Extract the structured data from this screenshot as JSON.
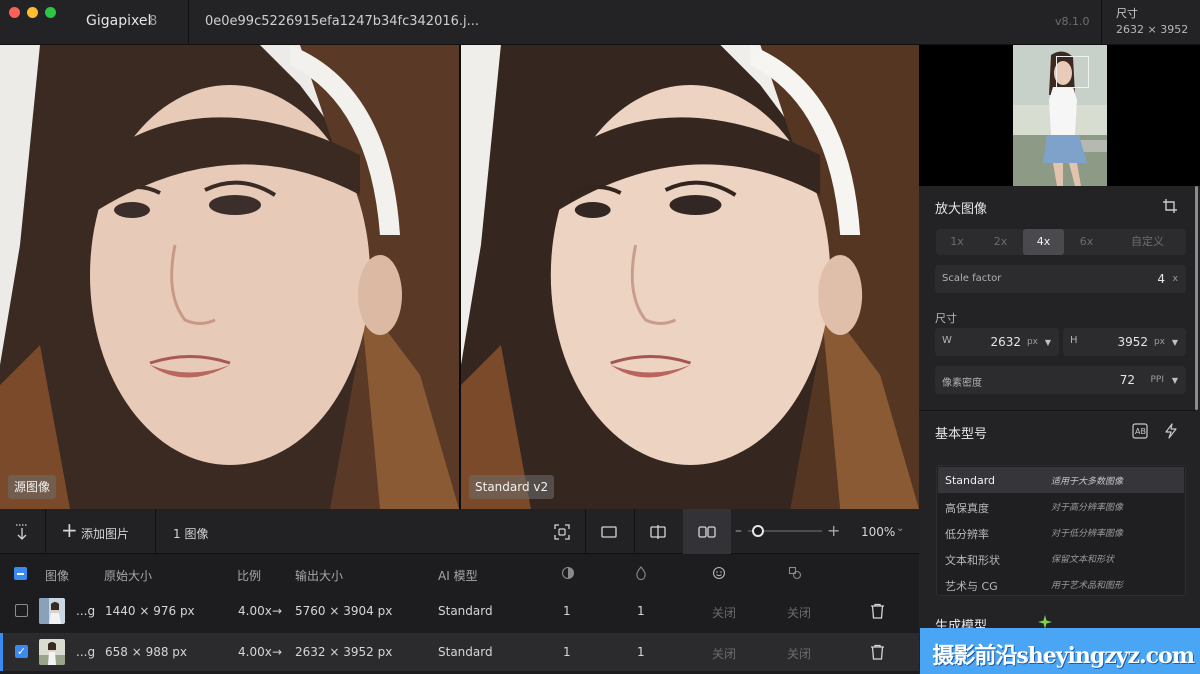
{
  "window": {
    "app_name": "Gigapixel",
    "app_version": "8",
    "file_name": "0e0e99c5226915efa1247b34fc342016.j...",
    "build_version": "v8.1.0",
    "size_label": "尺寸",
    "size_value": "2632 × 3952"
  },
  "preview": {
    "left_label": "源图像",
    "right_label": "Standard v2"
  },
  "toolbar": {
    "add_label": "添加图片",
    "count_label": "1 图像",
    "zoom_value": "100%",
    "zoom_level": 0.1
  },
  "table": {
    "headers": {
      "image": "图像",
      "original_size": "原始大小",
      "ratio": "比例",
      "output_size": "输出大小",
      "ai_model": "AI 模型"
    },
    "rows": [
      {
        "name": "...g",
        "original_size": "1440 × 976 px",
        "ratio": "4.00x",
        "arrow": "→",
        "output_size": "5760 × 3904 px",
        "model": "Standard",
        "col_a": "1",
        "col_b": "1",
        "col_c": "关闭",
        "col_d": "关闭",
        "checked": false
      },
      {
        "name": "...g",
        "original_size": "658 × 988 px",
        "ratio": "4.00x",
        "arrow": "→",
        "output_size": "2632 × 3952 px",
        "model": "Standard",
        "col_a": "1",
        "col_b": "1",
        "col_c": "关闭",
        "col_d": "关闭",
        "checked": true
      }
    ]
  },
  "panel": {
    "upscale_title": "放大图像",
    "scale_options": [
      "1x",
      "2x",
      "4x",
      "6x",
      "自定义"
    ],
    "scale_selected": "4x",
    "scale_factor_label": "Scale factor",
    "scale_factor_value": "4",
    "scale_factor_unit": "x",
    "dimensions_label": "尺寸",
    "width_label": "W",
    "width_value": "2632",
    "width_unit": "px",
    "height_label": "H",
    "height_value": "3952",
    "height_unit": "px",
    "density_label": "像素密度",
    "density_value": "72",
    "density_unit": "PPI",
    "basic_model_title": "基本型号",
    "models": [
      {
        "name": "Standard",
        "desc": "适用于大多数图像"
      },
      {
        "name": "高保真度",
        "desc": "对于高分辨率图像"
      },
      {
        "name": "低分辨率",
        "desc": "对于低分辨率图像"
      },
      {
        "name": "文本和形状",
        "desc": "保留文本和形状"
      },
      {
        "name": "艺术与 CG",
        "desc": "用于艺术品和图形"
      }
    ],
    "generative_title": "生成模型"
  },
  "watermark": {
    "text": "摄影前沿sheyingzyz.com"
  },
  "colors": {
    "accent": "#3a8bf0",
    "background": "#1b1b1d",
    "panel": "#232326"
  }
}
